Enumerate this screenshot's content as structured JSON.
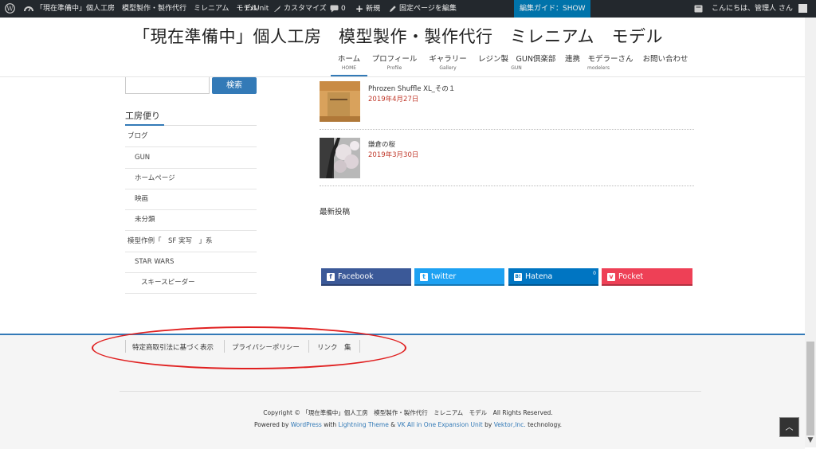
{
  "admin_bar": {
    "site_name": "「現在準備中」個人工房　模型製作・製作代行　ミレニアム　モデル",
    "comments_count": "0",
    "new_label": "新規",
    "edit_label": "固定ページを編集",
    "customize_label": "カスタマイズ",
    "exunit_label": "ExUnit",
    "guide_label": "編集ガイド：SHOW",
    "greeting": "こんにちは、管理人 さん"
  },
  "header": {
    "site_title": "「現在準備中」個人工房　模型製作・製作代行　ミレニアム　モデル",
    "nav": [
      {
        "label": "ホーム",
        "sub": "HOME"
      },
      {
        "label": "プロフィール",
        "sub": "Profile"
      },
      {
        "label": "ギャラリー",
        "sub": "Gallery"
      },
      {
        "label": "レジン製　GUN倶楽部",
        "sub": "GUN"
      },
      {
        "label": "連携　モデラーさん",
        "sub": "modelers"
      },
      {
        "label": "お問い合わせ",
        "sub": ""
      }
    ]
  },
  "sidebar": {
    "search_button": "検索",
    "category_heading": "工房便り",
    "categories": [
      "ブログ",
      "GUN",
      "ホームページ",
      "映画",
      "未分類",
      "模型作例「　SF 実写　」系",
      "STAR WARS",
      "スキースピーダー"
    ]
  },
  "posts": [
    {
      "title": "Phrozen Shuffle XL_その１",
      "date": "2019年4月27日"
    },
    {
      "title": "鎌倉の桜",
      "date": "2019年3月30日"
    }
  ],
  "recent_heading": "最新投稿",
  "share": {
    "facebook": "Facebook",
    "twitter": "twitter",
    "hatena": "Hatena",
    "hatena_count": "0",
    "pocket": "Pocket"
  },
  "footer": {
    "nav": [
      "特定商取引法に基づく表示",
      "プライバシーポリシー",
      "リンク　集"
    ],
    "copyright": "Copyright © 「現在準備中」個人工房　模型製作・製作代行　ミレニアム　モデル　All Rights Reserved.",
    "powered_prefix": "Powered by ",
    "powered_wp": "WordPress",
    "powered_with": " with ",
    "powered_theme": "Lightning Theme",
    "powered_amp": " & ",
    "powered_unit": "VK All in One Expansion Unit",
    "powered_by": " by ",
    "powered_vektor": "Vektor,Inc.",
    "powered_suffix": " technology."
  },
  "colors": {
    "accent": "#337ab7",
    "date": "#c0392b",
    "annotation": "#e02020"
  }
}
